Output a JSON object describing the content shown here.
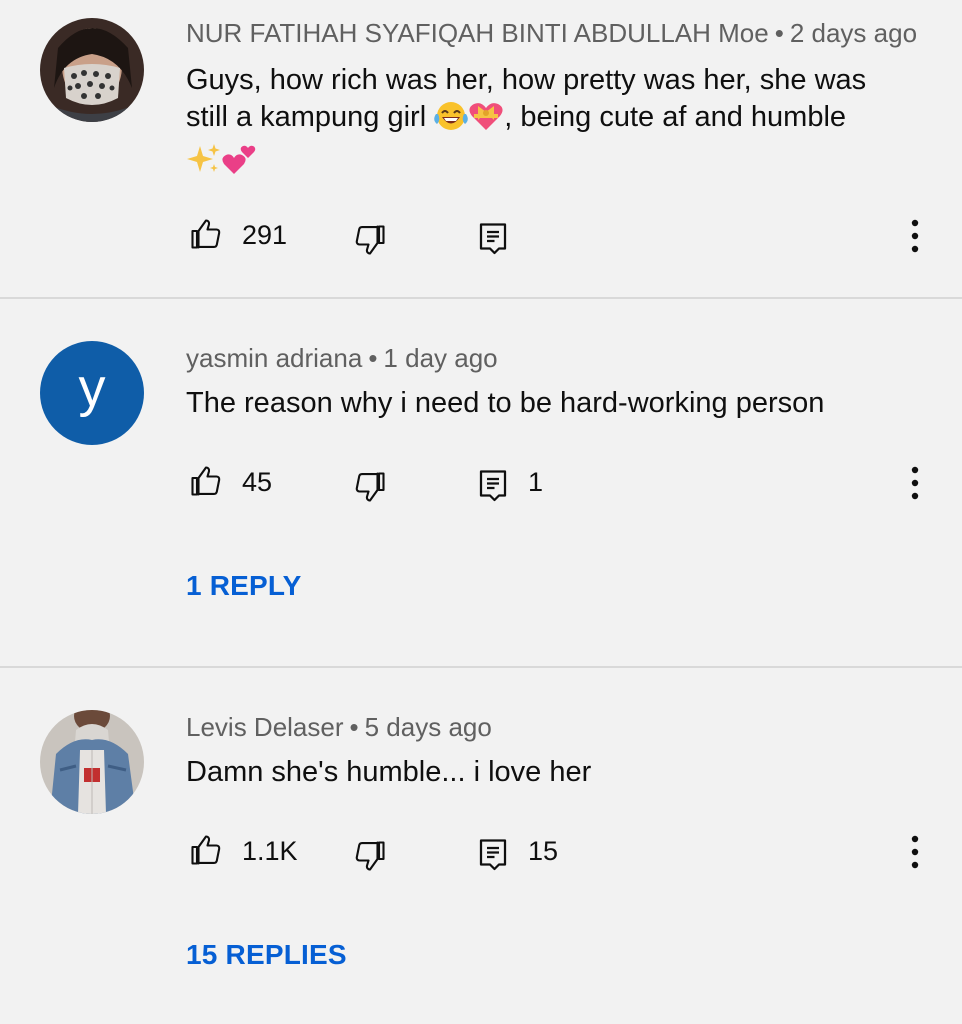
{
  "comments": [
    {
      "author": "NUR FATIHAH SYAFIQAH BINTI ABDULLAH Moe",
      "separator": "•",
      "time": "2 days ago",
      "text_line1": "Guys, how rich was her, how pretty was her, she was",
      "text_line2_a": "still a kampung girl ",
      "text_line2_b": ", being cute af and humble",
      "emojis": [
        "face-with-tears-of-joy",
        "heart-with-ribbon",
        "sparkles",
        "two-hearts"
      ],
      "likes": "291",
      "reply_count": "",
      "replies_link": ""
    },
    {
      "author": "yasmin adriana",
      "avatar_letter": "y",
      "avatar_color": "#0f5da8",
      "separator": "•",
      "time": "1 day ago",
      "text": "The reason why i need to be hard-working person",
      "likes": "45",
      "reply_count": "1",
      "replies_link": "1 REPLY"
    },
    {
      "author": "Levis Delaser",
      "separator": "•",
      "time": "5 days ago",
      "text": "Damn she's humble... i love her",
      "likes": "1.1K",
      "reply_count": "15",
      "replies_link": "15 REPLIES"
    }
  ],
  "colors": {
    "background": "#f2f2f2",
    "meta_text": "#606060",
    "link_blue": "#065fd4",
    "divider": "#d9d9d9"
  }
}
